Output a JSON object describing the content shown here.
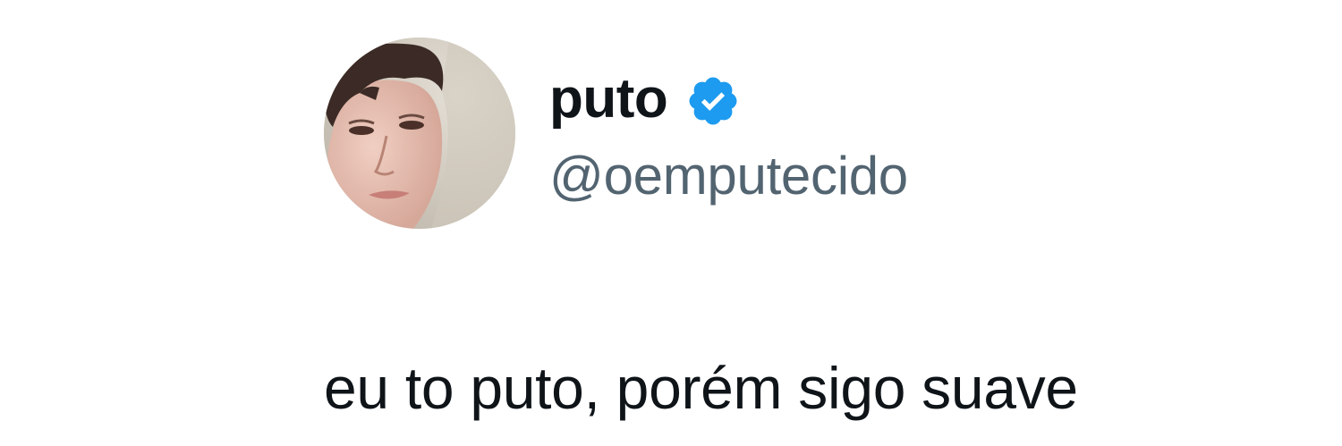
{
  "tweet": {
    "author": {
      "display_name": "puto",
      "handle": "@oemputecido",
      "verified": true,
      "avatar_icon": "user-avatar-photo",
      "verified_badge_icon": "verified-badge-icon",
      "verified_color": "#1d9bf0"
    },
    "text": "eu to puto, porém sigo suave"
  },
  "colors": {
    "text_primary": "#0f1419",
    "text_secondary": "#536471",
    "background": "#ffffff"
  }
}
